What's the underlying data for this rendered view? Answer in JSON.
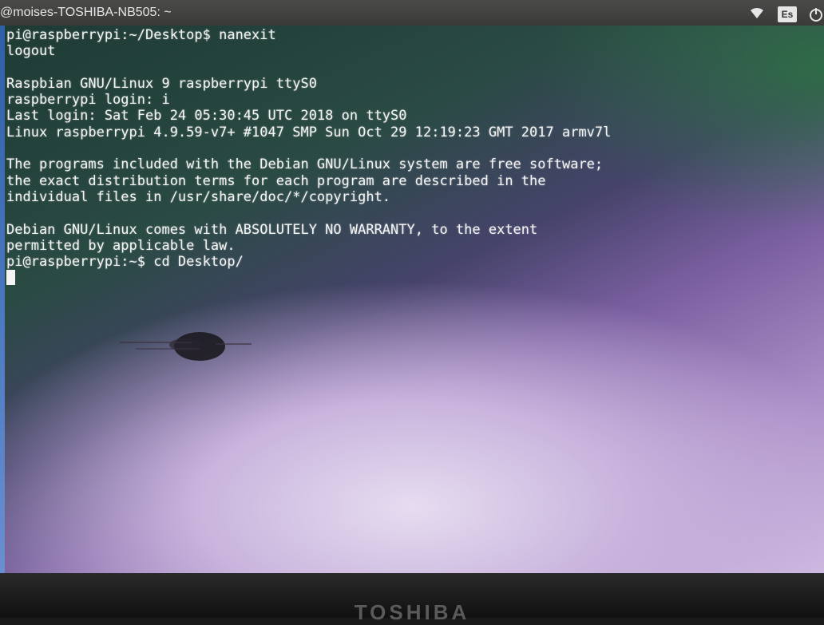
{
  "topbar": {
    "window_title": "@moises-TOSHIBA-NB505: ~",
    "lang_indicator": "Es"
  },
  "terminal": {
    "lines": [
      "pi@raspberrypi:~/Desktop$ nanexit",
      "logout",
      "",
      "Raspbian GNU/Linux 9 raspberrypi ttyS0",
      "raspberrypi login: i",
      "Last login: Sat Feb 24 05:30:45 UTC 2018 on ttyS0",
      "Linux raspberrypi 4.9.59-v7+ #1047 SMP Sun Oct 29 12:19:23 GMT 2017 armv7l",
      "",
      "The programs included with the Debian GNU/Linux system are free software;",
      "the exact distribution terms for each program are described in the",
      "individual files in /usr/share/doc/*/copyright.",
      "",
      "Debian GNU/Linux comes with ABSOLUTELY NO WARRANTY, to the extent",
      "permitted by applicable law.",
      "pi@raspberrypi:~$ cd Desktop/"
    ]
  },
  "bezel": {
    "brand": "TOSHIBA"
  },
  "icons": {
    "wifi": "wifi-icon",
    "power": "power-icon"
  }
}
